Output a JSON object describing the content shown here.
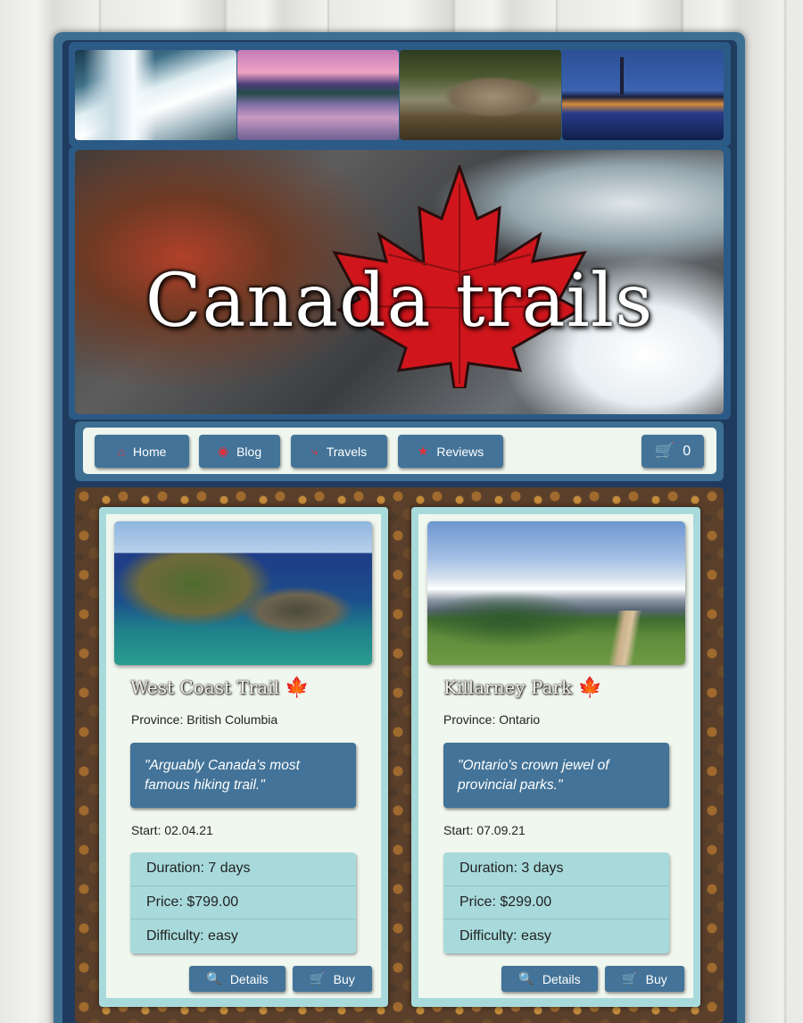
{
  "site": {
    "title": "Canada trails"
  },
  "nav": {
    "items": [
      {
        "label": "Home",
        "icon": "home-icon"
      },
      {
        "label": "Blog",
        "icon": "blog-icon"
      },
      {
        "label": "Travels",
        "icon": "route-icon"
      },
      {
        "label": "Reviews",
        "icon": "star-icon"
      }
    ],
    "cart": {
      "icon": "cart-icon",
      "count": "0"
    }
  },
  "trails": [
    {
      "name": "West Coast Trail",
      "province": "Province: British Columbia",
      "quote": "\"Arguably Canada's most famous hiking trail.\"",
      "start": "Start: 02.04.21",
      "duration": "Duration: 7 days",
      "price": "Price: $799.00",
      "difficulty": "Difficulty: easy",
      "details_label": "Details",
      "buy_label": "Buy"
    },
    {
      "name": "Killarney Park",
      "province": "Province: Ontario",
      "quote": "\"Ontario's crown jewel of provincial parks.\"",
      "start": "Start: 07.09.21",
      "duration": "Duration: 3 days",
      "price": "Price: $299.00",
      "difficulty": "Difficulty: easy",
      "details_label": "Details",
      "buy_label": "Buy"
    }
  ],
  "colors": {
    "accent": "#437398",
    "card_border": "#a8dadc",
    "icon_red": "#e0303a"
  }
}
